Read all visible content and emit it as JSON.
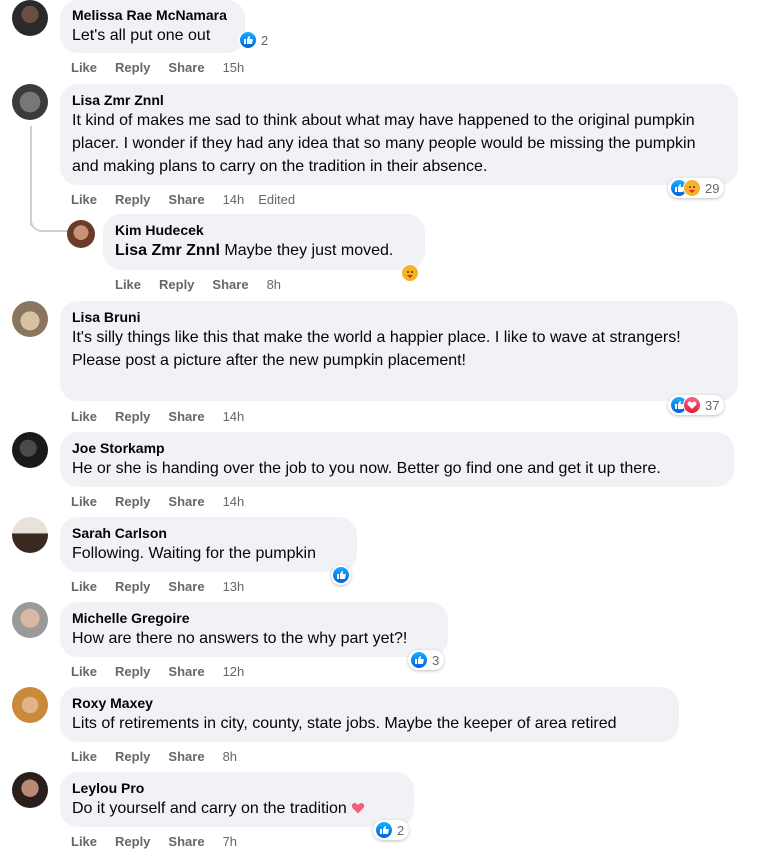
{
  "actions": {
    "like": "Like",
    "reply": "Reply",
    "share": "Share",
    "edited": "Edited"
  },
  "colors": {
    "bubble": "#f0f2f5",
    "meta": "#65676b",
    "like_blue": "#1877f2",
    "love_red": "#e61739"
  },
  "comments": [
    {
      "name": "Melissa Rae McNamara",
      "text": "Let's all put one out",
      "time": "15h",
      "reactions": [
        "like"
      ],
      "count": "2"
    },
    {
      "name": "Lisa Zmr Znnl",
      "text": "It kind of makes me sad to think about what may have happened to the original pumpkin placer. I wonder if they had any idea that so many people would be missing the pumpkin and making plans to carry on the tradition in their absence.",
      "time": "14h",
      "reactions": [
        "like",
        "care"
      ],
      "count": "29"
    },
    {
      "name": "Kim Hudecek",
      "mention": "Lisa Zmr Znnl",
      "text": "Maybe they just moved.",
      "time": "8h",
      "reactions": [
        "care"
      ],
      "count": ""
    },
    {
      "name": "Lisa Bruni",
      "text": "It's silly things like this that make the world a happier place. I like to wave at strangers!\nPlease post a picture after the new pumpkin placement!",
      "time": "14h",
      "reactions": [
        "like",
        "love"
      ],
      "count": "37"
    },
    {
      "name": "Joe Storkamp",
      "text": "He or she is handing over the job to you now. Better go find one and get it up there.",
      "time": "14h",
      "reactions": [],
      "count": ""
    },
    {
      "name": "Sarah Carlson",
      "text": "Following. Waiting for the pumpkin",
      "time": "13h",
      "reactions": [
        "like"
      ],
      "count": ""
    },
    {
      "name": "Michelle Gregoire",
      "text": "How are there no answers to the why part yet?!",
      "time": "12h",
      "reactions": [
        "like"
      ],
      "count": "3"
    },
    {
      "name": "Roxy Maxey",
      "text": "Lits of retirements in city, county, state jobs. Maybe the keeper of area retired",
      "time": "8h",
      "reactions": [],
      "count": ""
    },
    {
      "name": "Leylou Pro",
      "text": "Do it yourself and carry on the tradition",
      "emoji": "heart",
      "time": "7h",
      "reactions": [
        "like"
      ],
      "count": "2"
    }
  ]
}
